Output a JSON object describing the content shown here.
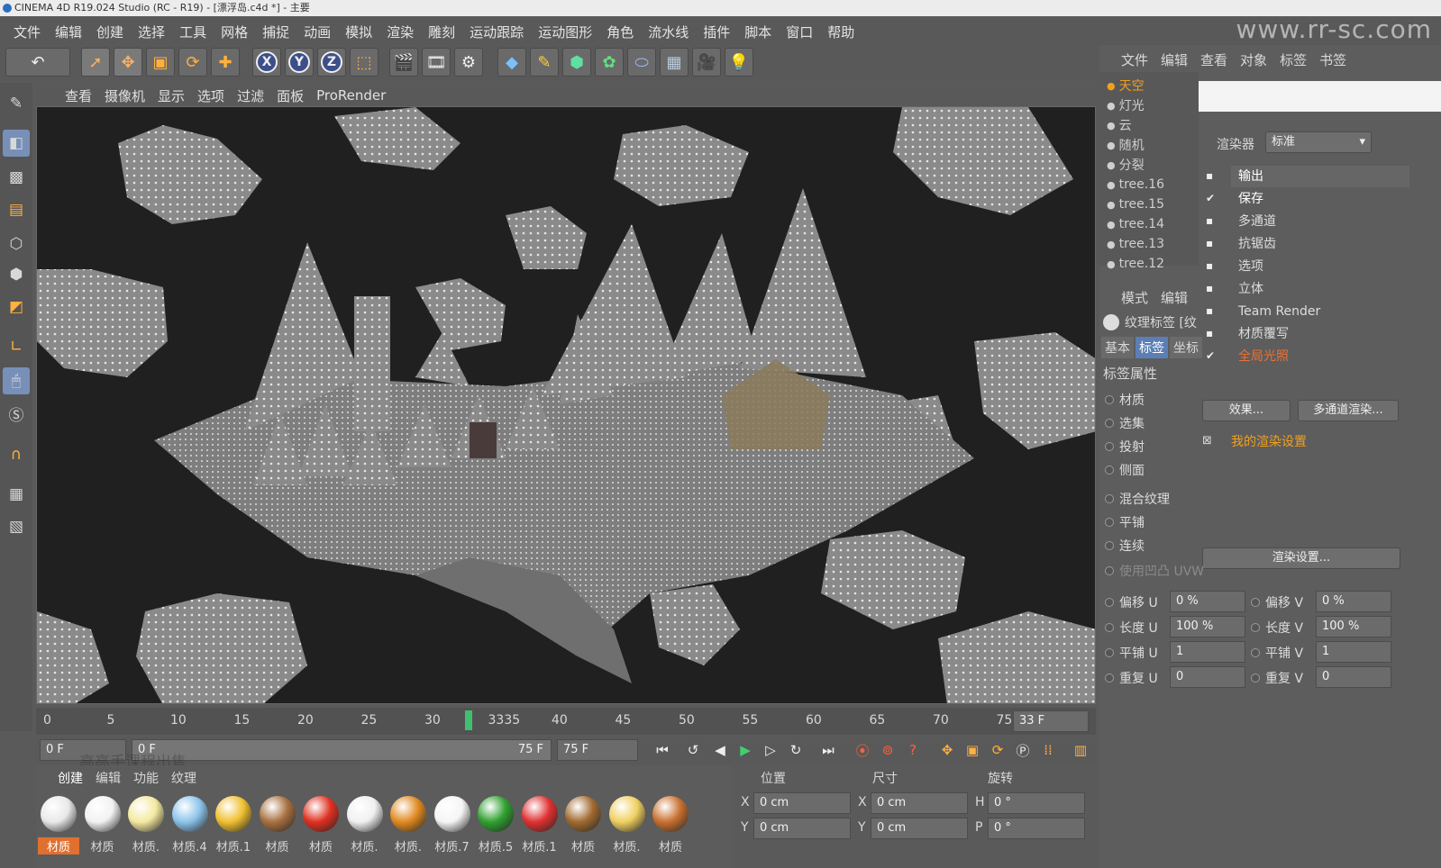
{
  "window": {
    "title": "CINEMA 4D R19.024 Studio (RC - R19) - [漂浮岛.c4d *] - 主要"
  },
  "watermark": "www.rr-sc.com",
  "menu": [
    "文件",
    "编辑",
    "创建",
    "选择",
    "工具",
    "网格",
    "捕捉",
    "动画",
    "模拟",
    "渲染",
    "雕刻",
    "运动跟踪",
    "运动图形",
    "角色",
    "流水线",
    "插件",
    "脚本",
    "窗口",
    "帮助"
  ],
  "toolbar": {
    "axes": [
      "X",
      "Y",
      "Z"
    ],
    "icons": [
      "undo-icon",
      "select-icon",
      "move-icon",
      "scale-icon",
      "rotate-icon",
      "add-icon",
      "x-axis-icon",
      "y-axis-icon",
      "z-axis-icon",
      "coord-icon",
      "render-view-icon",
      "render-icon",
      "render-settings-icon",
      "cube-icon",
      "pen-icon",
      "subdivide-icon",
      "array-icon",
      "deform-icon",
      "floor-icon",
      "camera-icon",
      "light-icon"
    ]
  },
  "viewport_menu": [
    "查看",
    "摄像机",
    "显示",
    "选项",
    "过滤",
    "面板",
    "ProRender"
  ],
  "timeline": {
    "ticks": [
      "0",
      "5",
      "10",
      "15",
      "20",
      "25",
      "30",
      "3335",
      "40",
      "45",
      "50",
      "55",
      "60",
      "65",
      "70",
      "75"
    ],
    "current_frame": "33 F"
  },
  "playbar": {
    "start": "0 F",
    "range_start": "0 F",
    "range_end": "75 F",
    "end": "75 F"
  },
  "overlay_text": "高高手课程出售",
  "material_tabs": [
    "创建",
    "编辑",
    "功能",
    "纹理"
  ],
  "materials": [
    {
      "label": "材质",
      "color": "#e8e8e8"
    },
    {
      "label": "材质",
      "color": "#f2f2f2"
    },
    {
      "label": "材质.",
      "color": "#f4e9a0"
    },
    {
      "label": "材质.4",
      "color": "#8cc4ea"
    },
    {
      "label": "材质.1",
      "color": "#f0c030"
    },
    {
      "label": "材质",
      "color": "#a87040"
    },
    {
      "label": "材质",
      "color": "#e03020"
    },
    {
      "label": "材质.",
      "color": "#f0f0f0"
    },
    {
      "label": "材质.",
      "color": "#e08a20"
    },
    {
      "label": "材质.7",
      "color": "#f5f5f5"
    },
    {
      "label": "材质.5",
      "color": "#30a030"
    },
    {
      "label": "材质.1",
      "color": "#e03030"
    },
    {
      "label": "材质",
      "color": "#a06a30"
    },
    {
      "label": "材质.",
      "color": "#f0d060"
    },
    {
      "label": "材质",
      "color": "#c87030"
    }
  ],
  "coords": {
    "headers": [
      "位置",
      "尺寸",
      "旋转"
    ],
    "rows": [
      {
        "a": "X",
        "av": "0 cm",
        "b": "X",
        "bv": "0 cm",
        "c": "H",
        "cv": "0 °"
      },
      {
        "a": "Y",
        "av": "0 cm",
        "b": "Y",
        "bv": "0 cm",
        "c": "P",
        "cv": "0 °"
      }
    ]
  },
  "object_manager": {
    "menu": [
      "文件",
      "编辑",
      "查看",
      "对象",
      "标签",
      "书签"
    ],
    "objects": [
      {
        "name": "天空",
        "color": "#f0a020"
      },
      {
        "name": "灯光",
        "color": "#cfcfcf"
      },
      {
        "name": "云",
        "color": "#cfcfcf"
      },
      {
        "name": "随机",
        "color": "#cfcfcf"
      },
      {
        "name": "分裂",
        "color": "#cfcfcf"
      },
      {
        "name": "tree.16",
        "color": "#cfcfcf"
      },
      {
        "name": "tree.15",
        "color": "#cfcfcf"
      },
      {
        "name": "tree.14",
        "color": "#cfcfcf"
      },
      {
        "name": "tree.13",
        "color": "#cfcfcf"
      },
      {
        "name": "tree.12",
        "color": "#cfcfcf"
      }
    ]
  },
  "render_settings": {
    "renderer_label": "渲染器",
    "renderer_value": "标准",
    "items": [
      {
        "label": "输出",
        "checked": false,
        "color": "#ffffff"
      },
      {
        "label": "保存",
        "checked": true,
        "color": "#ffffff"
      },
      {
        "label": "多通道",
        "checked": false,
        "color": "#dddddd"
      },
      {
        "label": "抗锯齿",
        "checked": false,
        "color": "#dddddd"
      },
      {
        "label": "选项",
        "checked": false,
        "color": "#dddddd"
      },
      {
        "label": "立体",
        "checked": false,
        "color": "#dddddd"
      },
      {
        "label": "Team Render",
        "checked": false,
        "color": "#dddddd"
      },
      {
        "label": "材质覆写",
        "checked": false,
        "color": "#dddddd"
      },
      {
        "label": "全局光照",
        "checked": true,
        "color": "#f07030"
      }
    ],
    "effect_button": "效果...",
    "multipass_button": "多通道渲染...",
    "setting_name": "我的渲染设置",
    "settings_button": "渲染设置..."
  },
  "attributes": {
    "menu": [
      "模式",
      "编辑"
    ],
    "tag_title": "纹理标签 [纹",
    "tabs": [
      "基本",
      "标签",
      "坐标"
    ],
    "section": "标签属性",
    "props": [
      "材质",
      "选集",
      "投射",
      "侧面",
      "混合纹理",
      "平铺",
      "连续",
      "使用凹凸 UVW"
    ],
    "uv_rows": [
      {
        "l": "偏移 U",
        "lv": "0 %",
        "r": "偏移 V",
        "rv": "0 %"
      },
      {
        "l": "长度 U",
        "lv": "100 %",
        "r": "长度 V",
        "rv": "100 %"
      },
      {
        "l": "平铺 U",
        "lv": "1",
        "r": "平铺 V",
        "rv": "1"
      },
      {
        "l": "重复 U",
        "lv": "0",
        "r": "重复 V",
        "rv": "0"
      }
    ]
  }
}
